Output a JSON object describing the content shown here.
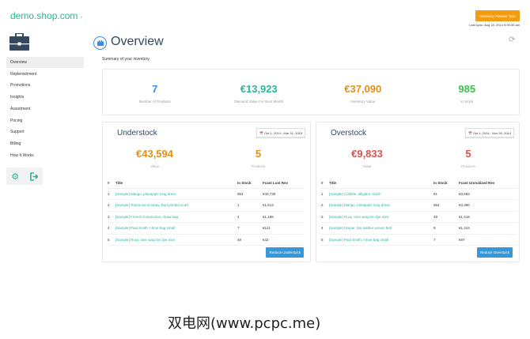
{
  "header": {
    "brand": "demo.shop.com",
    "brand_caret": "-",
    "tour_button": "Inventory Planner Tour",
    "last_sync": "Last sync: Aug 18, 2014 9:05:35 am"
  },
  "sidebar": {
    "items": [
      {
        "label": "Overview",
        "active": true
      },
      {
        "label": "Replenishment"
      },
      {
        "label": "Promotions"
      },
      {
        "label": "Insights"
      },
      {
        "label": "Assortment"
      },
      {
        "label": "Pricing"
      },
      {
        "label": "Support"
      },
      {
        "label": "Billing"
      },
      {
        "label": "How It Works"
      }
    ]
  },
  "main": {
    "title": "Overview",
    "summary": "Summary of your inventory.",
    "stats": [
      {
        "value": "7",
        "label": "Number of Products",
        "color": "#3a8dde"
      },
      {
        "value": "€13,923",
        "label": "Demand Value For Next Month",
        "color": "#2cb59a"
      },
      {
        "value": "€37,090",
        "label": "Inventory Value",
        "color": "#e0901a"
      },
      {
        "value": "985",
        "label": "In Stock",
        "color": "#3cc04a"
      }
    ],
    "understock": {
      "title": "Understock",
      "date_range": "Oct 1, 2014 - Mar 31, 2015",
      "value": "€43,594",
      "value_label": "Value",
      "products": "5",
      "products_label": "Products",
      "color": "#e0901a",
      "columns": [
        "#",
        "Title",
        "In Stock",
        "Fcast Lost Rev"
      ],
      "rows": [
        [
          "1",
          "[Sample] Mango, pineapple long dress",
          "854",
          "€40,730"
        ],
        [
          "2",
          "[Sample] Tomorrow is today, Red printed scarf",
          "1",
          "€1,513"
        ],
        [
          "3",
          "[Sample] French Connection, straw bag",
          "4",
          "€1,188"
        ],
        [
          "4",
          "[Sample] Paul Smith, t-time bag small",
          "7",
          "€121"
        ],
        [
          "5",
          "[Sample] Roxy, time warp tie dye mini",
          "49",
          "€42"
        ]
      ],
      "button": "Reduce Understock"
    },
    "overstock": {
      "title": "Overstock",
      "date_range": "Oct 1, 2014 - Nov 30, 2014",
      "value": "€9,833",
      "value_label": "Value",
      "products": "5",
      "products_label": "Products",
      "color": "#d9534f",
      "columns": [
        "#",
        "Title",
        "In Stock",
        "Fcast Unrealized Rev"
      ],
      "rows": [
        [
          "1",
          "[Sample] Collette, alligator clutch",
          "61",
          "€3,594"
        ],
        [
          "2",
          "[Sample] Mango, pineapple long dress",
          "854",
          "€3,390"
        ],
        [
          "3",
          "[Sample] Roxy, time warp tie dye mini",
          "49",
          "€1,418"
        ],
        [
          "4",
          "[Sample] Harper, tan leather woven belt",
          "9",
          "€1,344"
        ],
        [
          "5",
          "[Sample] Paul Smith, t-time bag small",
          "7",
          "€87"
        ]
      ],
      "button": "Reduce Overstock"
    }
  },
  "watermark": "双电网(www.pcpc.me)"
}
